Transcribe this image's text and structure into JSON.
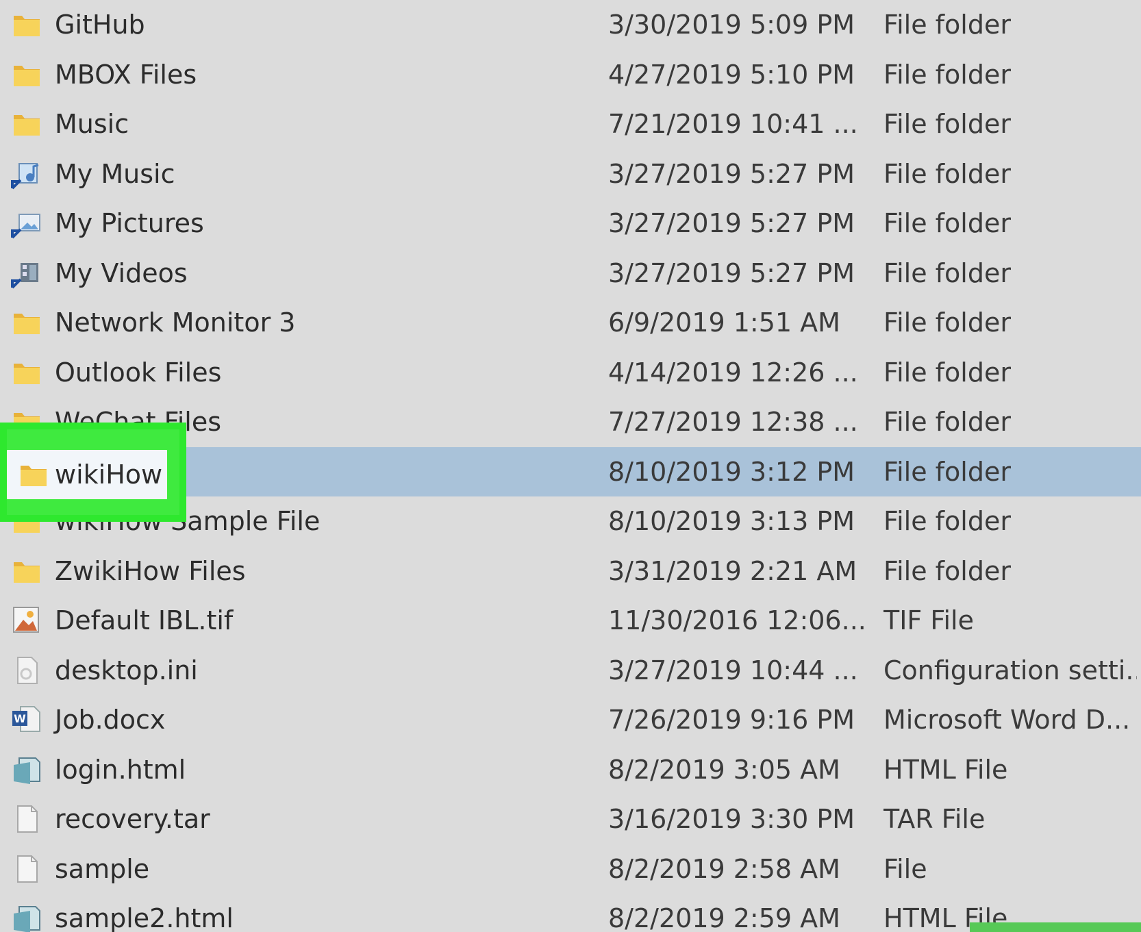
{
  "files": [
    {
      "name": "GitHub",
      "date": "3/30/2019 5:09 PM",
      "type": "File folder",
      "icon": "folder-icon"
    },
    {
      "name": "MBOX Files",
      "date": "4/27/2019 5:10 PM",
      "type": "File folder",
      "icon": "folder-icon"
    },
    {
      "name": "Music",
      "date": "7/21/2019 10:41 ...",
      "type": "File folder",
      "icon": "folder-icon"
    },
    {
      "name": "My Music",
      "date": "3/27/2019 5:27 PM",
      "type": "File folder",
      "icon": "music-shortcut-icon"
    },
    {
      "name": "My Pictures",
      "date": "3/27/2019 5:27 PM",
      "type": "File folder",
      "icon": "pictures-shortcut-icon"
    },
    {
      "name": "My Videos",
      "date": "3/27/2019 5:27 PM",
      "type": "File folder",
      "icon": "videos-shortcut-icon"
    },
    {
      "name": "Network Monitor 3",
      "date": "6/9/2019 1:51 AM",
      "type": "File folder",
      "icon": "folder-icon"
    },
    {
      "name": "Outlook Files",
      "date": "4/14/2019 12:26 ...",
      "type": "File folder",
      "icon": "folder-icon"
    },
    {
      "name": "WeChat Files",
      "date": "7/27/2019 12:38 ...",
      "type": "File folder",
      "icon": "folder-icon"
    },
    {
      "name": "wikiHow",
      "date": "8/10/2019 3:12 PM",
      "type": "File folder",
      "icon": "folder-icon",
      "selected": true
    },
    {
      "name": "wikiHow Sample File",
      "date": "8/10/2019 3:13 PM",
      "type": "File folder",
      "icon": "folder-icon"
    },
    {
      "name": "ZwikiHow Files",
      "date": "3/31/2019 2:21 AM",
      "type": "File folder",
      "icon": "folder-icon"
    },
    {
      "name": "Default IBL.tif",
      "date": "11/30/2016 12:06...",
      "type": "TIF File",
      "icon": "image-file-icon"
    },
    {
      "name": "desktop.ini",
      "date": "3/27/2019 10:44 ...",
      "type": "Configuration setti...",
      "icon": "settings-file-icon"
    },
    {
      "name": "Job.docx",
      "date": "7/26/2019 9:16 PM",
      "type": "Microsoft Word D...",
      "icon": "word-file-icon"
    },
    {
      "name": "login.html",
      "date": "8/2/2019 3:05 AM",
      "type": "HTML File",
      "icon": "html-file-icon"
    },
    {
      "name": "recovery.tar",
      "date": "3/16/2019 3:30 PM",
      "type": "TAR File",
      "icon": "blank-file-icon"
    },
    {
      "name": "sample",
      "date": "8/2/2019 2:58 AM",
      "type": "File",
      "icon": "blank-file-icon"
    },
    {
      "name": "sample2.html",
      "date": "8/2/2019 2:59 AM",
      "type": "HTML File",
      "icon": "html-file-icon"
    }
  ],
  "highlight": {
    "label": "wikiHow"
  },
  "colors": {
    "selection": "#a9c2d9",
    "highlight_border": "#2ee82e",
    "folder": "#f4c64e",
    "background": "#dcdcdc"
  }
}
